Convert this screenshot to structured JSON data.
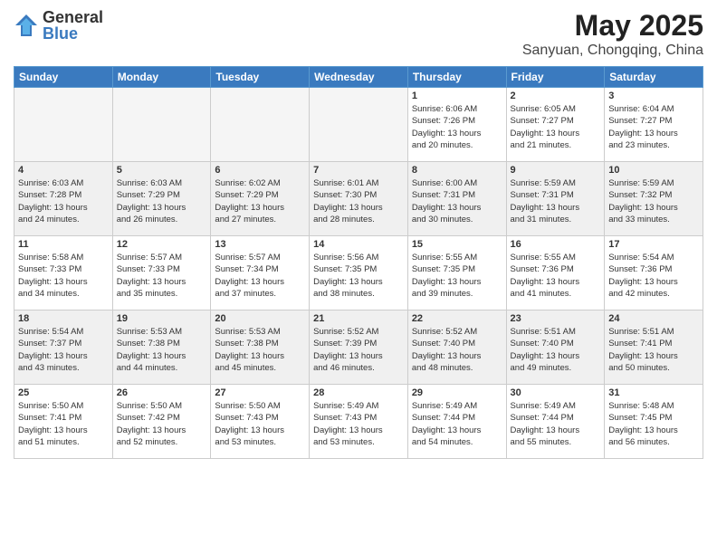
{
  "header": {
    "logo_general": "General",
    "logo_blue": "Blue",
    "month": "May 2025",
    "location": "Sanyuan, Chongqing, China"
  },
  "days_of_week": [
    "Sunday",
    "Monday",
    "Tuesday",
    "Wednesday",
    "Thursday",
    "Friday",
    "Saturday"
  ],
  "weeks": [
    [
      {
        "day": "",
        "info": "",
        "empty": true
      },
      {
        "day": "",
        "info": "",
        "empty": true
      },
      {
        "day": "",
        "info": "",
        "empty": true
      },
      {
        "day": "",
        "info": "",
        "empty": true
      },
      {
        "day": "1",
        "info": "Sunrise: 6:06 AM\nSunset: 7:26 PM\nDaylight: 13 hours\nand 20 minutes."
      },
      {
        "day": "2",
        "info": "Sunrise: 6:05 AM\nSunset: 7:27 PM\nDaylight: 13 hours\nand 21 minutes."
      },
      {
        "day": "3",
        "info": "Sunrise: 6:04 AM\nSunset: 7:27 PM\nDaylight: 13 hours\nand 23 minutes."
      }
    ],
    [
      {
        "day": "4",
        "info": "Sunrise: 6:03 AM\nSunset: 7:28 PM\nDaylight: 13 hours\nand 24 minutes."
      },
      {
        "day": "5",
        "info": "Sunrise: 6:03 AM\nSunset: 7:29 PM\nDaylight: 13 hours\nand 26 minutes."
      },
      {
        "day": "6",
        "info": "Sunrise: 6:02 AM\nSunset: 7:29 PM\nDaylight: 13 hours\nand 27 minutes."
      },
      {
        "day": "7",
        "info": "Sunrise: 6:01 AM\nSunset: 7:30 PM\nDaylight: 13 hours\nand 28 minutes."
      },
      {
        "day": "8",
        "info": "Sunrise: 6:00 AM\nSunset: 7:31 PM\nDaylight: 13 hours\nand 30 minutes."
      },
      {
        "day": "9",
        "info": "Sunrise: 5:59 AM\nSunset: 7:31 PM\nDaylight: 13 hours\nand 31 minutes."
      },
      {
        "day": "10",
        "info": "Sunrise: 5:59 AM\nSunset: 7:32 PM\nDaylight: 13 hours\nand 33 minutes."
      }
    ],
    [
      {
        "day": "11",
        "info": "Sunrise: 5:58 AM\nSunset: 7:33 PM\nDaylight: 13 hours\nand 34 minutes."
      },
      {
        "day": "12",
        "info": "Sunrise: 5:57 AM\nSunset: 7:33 PM\nDaylight: 13 hours\nand 35 minutes."
      },
      {
        "day": "13",
        "info": "Sunrise: 5:57 AM\nSunset: 7:34 PM\nDaylight: 13 hours\nand 37 minutes."
      },
      {
        "day": "14",
        "info": "Sunrise: 5:56 AM\nSunset: 7:35 PM\nDaylight: 13 hours\nand 38 minutes."
      },
      {
        "day": "15",
        "info": "Sunrise: 5:55 AM\nSunset: 7:35 PM\nDaylight: 13 hours\nand 39 minutes."
      },
      {
        "day": "16",
        "info": "Sunrise: 5:55 AM\nSunset: 7:36 PM\nDaylight: 13 hours\nand 41 minutes."
      },
      {
        "day": "17",
        "info": "Sunrise: 5:54 AM\nSunset: 7:36 PM\nDaylight: 13 hours\nand 42 minutes."
      }
    ],
    [
      {
        "day": "18",
        "info": "Sunrise: 5:54 AM\nSunset: 7:37 PM\nDaylight: 13 hours\nand 43 minutes."
      },
      {
        "day": "19",
        "info": "Sunrise: 5:53 AM\nSunset: 7:38 PM\nDaylight: 13 hours\nand 44 minutes."
      },
      {
        "day": "20",
        "info": "Sunrise: 5:53 AM\nSunset: 7:38 PM\nDaylight: 13 hours\nand 45 minutes."
      },
      {
        "day": "21",
        "info": "Sunrise: 5:52 AM\nSunset: 7:39 PM\nDaylight: 13 hours\nand 46 minutes."
      },
      {
        "day": "22",
        "info": "Sunrise: 5:52 AM\nSunset: 7:40 PM\nDaylight: 13 hours\nand 48 minutes."
      },
      {
        "day": "23",
        "info": "Sunrise: 5:51 AM\nSunset: 7:40 PM\nDaylight: 13 hours\nand 49 minutes."
      },
      {
        "day": "24",
        "info": "Sunrise: 5:51 AM\nSunset: 7:41 PM\nDaylight: 13 hours\nand 50 minutes."
      }
    ],
    [
      {
        "day": "25",
        "info": "Sunrise: 5:50 AM\nSunset: 7:41 PM\nDaylight: 13 hours\nand 51 minutes."
      },
      {
        "day": "26",
        "info": "Sunrise: 5:50 AM\nSunset: 7:42 PM\nDaylight: 13 hours\nand 52 minutes."
      },
      {
        "day": "27",
        "info": "Sunrise: 5:50 AM\nSunset: 7:43 PM\nDaylight: 13 hours\nand 53 minutes."
      },
      {
        "day": "28",
        "info": "Sunrise: 5:49 AM\nSunset: 7:43 PM\nDaylight: 13 hours\nand 53 minutes."
      },
      {
        "day": "29",
        "info": "Sunrise: 5:49 AM\nSunset: 7:44 PM\nDaylight: 13 hours\nand 54 minutes."
      },
      {
        "day": "30",
        "info": "Sunrise: 5:49 AM\nSunset: 7:44 PM\nDaylight: 13 hours\nand 55 minutes."
      },
      {
        "day": "31",
        "info": "Sunrise: 5:48 AM\nSunset: 7:45 PM\nDaylight: 13 hours\nand 56 minutes."
      }
    ]
  ]
}
